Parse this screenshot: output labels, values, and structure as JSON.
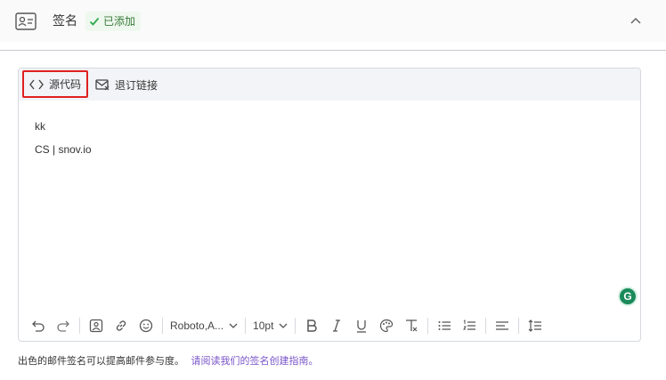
{
  "header": {
    "title": "签名",
    "status_badge": "已添加",
    "icons": {
      "card": "id-card-icon",
      "check": "check-icon",
      "collapse": "chevron-up-icon"
    }
  },
  "editor": {
    "topbar": {
      "source_code_label": "源代码",
      "unsubscribe_label": "退订链接"
    },
    "content_lines": [
      "kk",
      "CS | snov.io"
    ],
    "grammarly_letter": "G",
    "toolbar": {
      "font_family": "Roboto,A...",
      "font_size": "10pt",
      "buttons": [
        "undo-icon",
        "redo-icon",
        "image-icon",
        "link-icon",
        "emoji-icon",
        "bold-icon",
        "italic-icon",
        "underline-icon",
        "text-color-icon",
        "clear-format-icon",
        "bullet-list-icon",
        "numbered-list-icon",
        "align-icon",
        "line-height-icon"
      ]
    }
  },
  "footer": {
    "text": "出色的邮件签名可以提高邮件参与度。",
    "link": "请阅读我们的签名创建指南。"
  },
  "colors": {
    "accent_link": "#7a55c9",
    "highlight_border": "#e02020",
    "badge_green": "#3a7a3a"
  }
}
